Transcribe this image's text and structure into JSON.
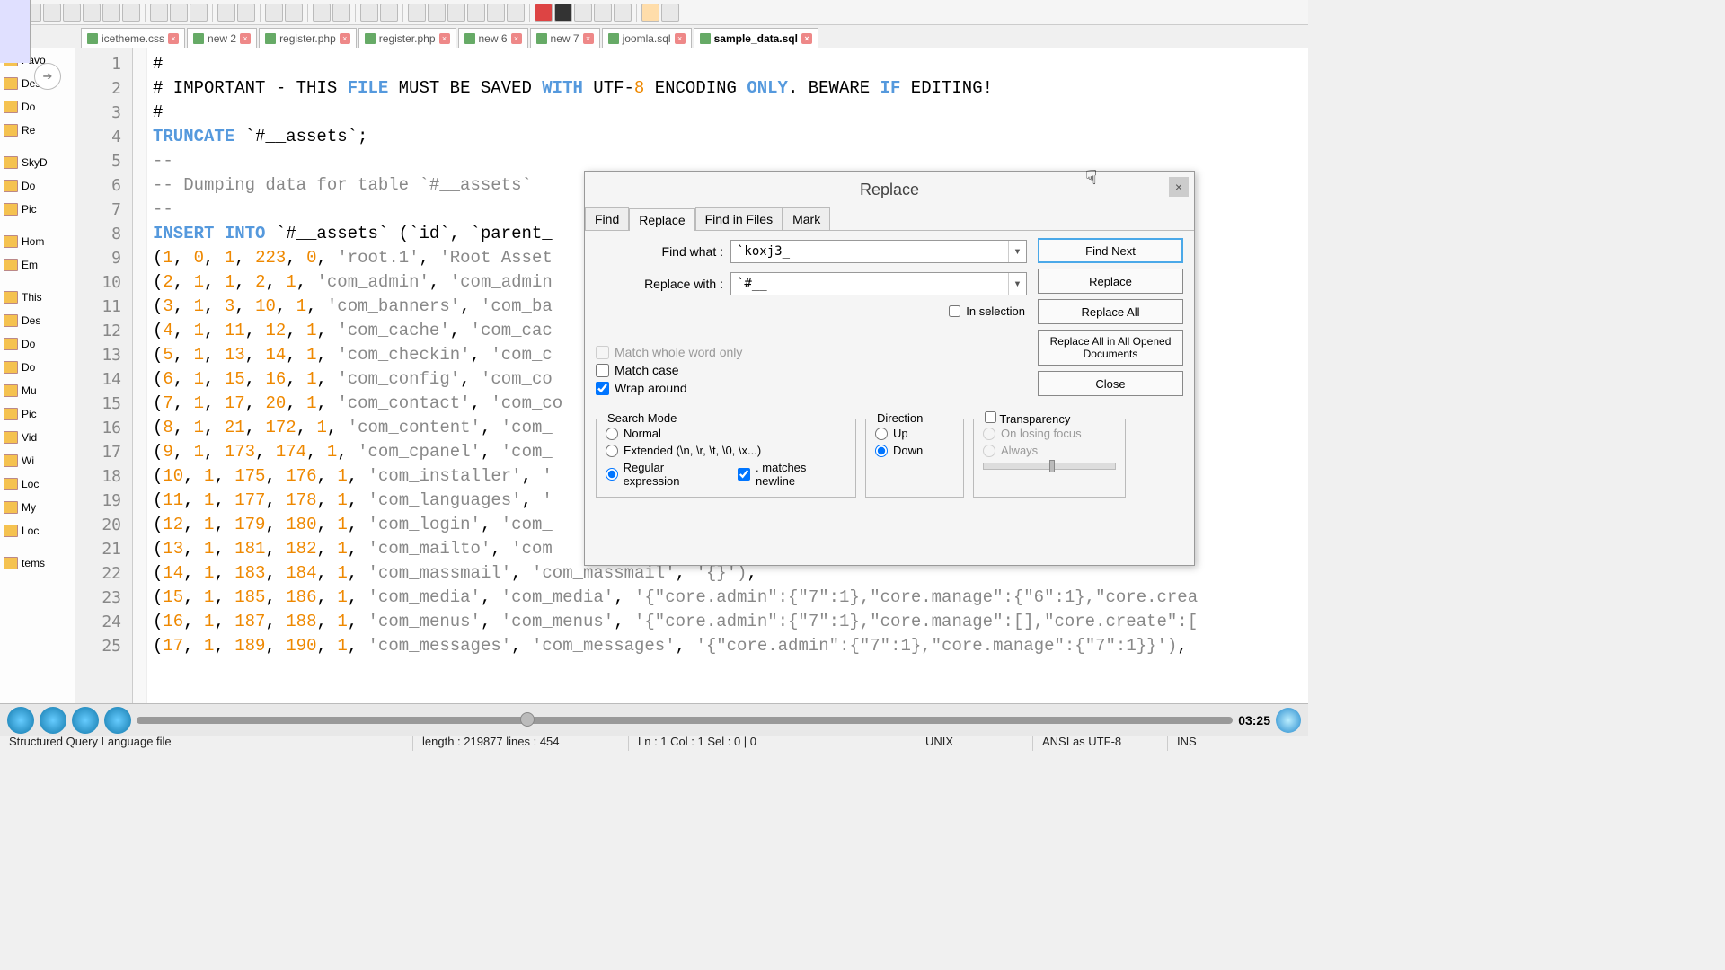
{
  "tabs": [
    {
      "label": "icetheme.css"
    },
    {
      "label": "new  2"
    },
    {
      "label": "register.php"
    },
    {
      "label": "register.php"
    },
    {
      "label": "new  6"
    },
    {
      "label": "new  7"
    },
    {
      "label": "joomla.sql"
    },
    {
      "label": "sample_data.sql"
    }
  ],
  "sidebar": {
    "items": [
      "Favo",
      "Des",
      "Do",
      "Re",
      "",
      "SkyD",
      "Do",
      "Pic",
      "",
      "Hom",
      "Em",
      "",
      "This",
      "Des",
      "Do",
      "Do",
      "Mu",
      "Pic",
      "Vid",
      "Wi",
      "Loc",
      "My",
      "Loc",
      "",
      "tems"
    ]
  },
  "editor": {
    "lines": [
      {
        "n": 1,
        "html": "#"
      },
      {
        "n": 2,
        "html": "# IMPORTANT - THIS <span class='kw'>FILE</span> MUST BE SAVED <span class='kw'>WITH</span> UTF-<span class='num'>8</span> ENCODING <span class='kw'>ONLY</span>. BEWARE <span class='kw'>IF</span> EDITING!"
      },
      {
        "n": 3,
        "html": "#"
      },
      {
        "n": 4,
        "html": "<span class='kw'>TRUNCATE</span> `#__assets`;"
      },
      {
        "n": 5,
        "html": "<span class='cmt'>--</span>"
      },
      {
        "n": 6,
        "html": "<span class='cmt'>-- Dumping data for table `#__assets`</span>"
      },
      {
        "n": 7,
        "html": "<span class='cmt'>--</span>"
      },
      {
        "n": 8,
        "html": "<span class='kw'>INSERT INTO</span> `#__assets` (`id`, `parent_                                                 <span class='kw'>UES</span>"
      },
      {
        "n": 9,
        "html": "(<span class='num'>1</span>, <span class='num'>0</span>, <span class='num'>1</span>, <span class='num'>223</span>, <span class='num'>0</span>, <span class='str'>'root.1'</span>, <span class='str'>'Root Asset                                                \"6\":1},</span>"
      },
      {
        "n": 10,
        "html": "(<span class='num'>2</span>, <span class='num'>1</span>, <span class='num'>1</span>, <span class='num'>2</span>, <span class='num'>1</span>, <span class='str'>'com_admin'</span>, <span class='str'>'com_admin</span>"
      },
      {
        "n": 11,
        "html": "(<span class='num'>3</span>, <span class='num'>1</span>, <span class='num'>3</span>, <span class='num'>10</span>, <span class='num'>1</span>, <span class='str'>'com_banners'</span>, <span class='str'>'com_ba                                                e.creat</span>"
      },
      {
        "n": 12,
        "html": "(<span class='num'>4</span>, <span class='num'>1</span>, <span class='num'>11</span>, <span class='num'>12</span>, <span class='num'>1</span>, <span class='str'>'com_cache'</span>, <span class='str'>'com_cac</span>"
      },
      {
        "n": 13,
        "html": "(<span class='num'>5</span>, <span class='num'>1</span>, <span class='num'>13</span>, <span class='num'>14</span>, <span class='num'>1</span>, <span class='str'>'com_checkin'</span>, <span class='str'>'com_c</span>"
      },
      {
        "n": 14,
        "html": "(<span class='num'>6</span>, <span class='num'>1</span>, <span class='num'>15</span>, <span class='num'>16</span>, <span class='num'>1</span>, <span class='str'>'com_config'</span>, <span class='str'>'com_co</span>"
      },
      {
        "n": 15,
        "html": "(<span class='num'>7</span>, <span class='num'>1</span>, <span class='num'>17</span>, <span class='num'>20</span>, <span class='num'>1</span>, <span class='str'>'com_contact'</span>, <span class='str'>'com_co                                               re.crea</span>"
      },
      {
        "n": 16,
        "html": "(<span class='num'>8</span>, <span class='num'>1</span>, <span class='num'>21</span>, <span class='num'>172</span>, <span class='num'>1</span>, <span class='str'>'com_content'</span>, <span class='str'>'com_                                               ore.cre</span>"
      },
      {
        "n": 17,
        "html": "(<span class='num'>9</span>, <span class='num'>1</span>, <span class='num'>173</span>, <span class='num'>174</span>, <span class='num'>1</span>, <span class='str'>'com_cpanel'</span>, <span class='str'>'com_</span>"
      },
      {
        "n": 18,
        "html": "(<span class='num'>10</span>, <span class='num'>1</span>, <span class='num'>175</span>, <span class='num'>176</span>, <span class='num'>1</span>, <span class='str'>'com_installer'</span>, <span class='str'>'                                               core.de</span>"
      },
      {
        "n": 19,
        "html": "(<span class='num'>11</span>, <span class='num'>1</span>, <span class='num'>177</span>, <span class='num'>178</span>, <span class='num'>1</span>, <span class='str'>'com_languages'</span>, <span class='str'>'                                               core.cr</span>"
      },
      {
        "n": 20,
        "html": "(<span class='num'>12</span>, <span class='num'>1</span>, <span class='num'>179</span>, <span class='num'>180</span>, <span class='num'>1</span>, <span class='str'>'com_login'</span>, <span class='str'>'com_</span>"
      },
      {
        "n": 21,
        "html": "(<span class='num'>13</span>, <span class='num'>1</span>, <span class='num'>181</span>, <span class='num'>182</span>, <span class='num'>1</span>, <span class='str'>'com_mailto'</span>, <span class='str'>'com</span>"
      },
      {
        "n": 22,
        "html": "(<span class='num'>14</span>, <span class='num'>1</span>, <span class='num'>183</span>, <span class='num'>184</span>, <span class='num'>1</span>, <span class='str'>'com_massmail'</span>, <span class='str'>'com_massmail'</span>, <span class='str'>'{}')</span>,"
      },
      {
        "n": 23,
        "html": "(<span class='num'>15</span>, <span class='num'>1</span>, <span class='num'>185</span>, <span class='num'>186</span>, <span class='num'>1</span>, <span class='str'>'com_media'</span>, <span class='str'>'com_media'</span>, <span class='str'>'{\"core.admin\":{\"7\":1},\"core.manage\":{\"6\":1},\"core.crea</span>"
      },
      {
        "n": 24,
        "html": "(<span class='num'>16</span>, <span class='num'>1</span>, <span class='num'>187</span>, <span class='num'>188</span>, <span class='num'>1</span>, <span class='str'>'com_menus'</span>, <span class='str'>'com_menus'</span>, <span class='str'>'{\"core.admin\":{\"7\":1},\"core.manage\":[],\"core.create\":[</span>"
      },
      {
        "n": 25,
        "html": "(<span class='num'>17</span>, <span class='num'>1</span>, <span class='num'>189</span>, <span class='num'>190</span>, <span class='num'>1</span>, <span class='str'>'com_messages'</span>, <span class='str'>'com_messages'</span>, <span class='str'>'{\"core.admin\":{\"7\":1},\"core.manage\":{\"7\":1}}')</span>,"
      }
    ]
  },
  "statusbar": {
    "filetype": "Structured Query Language file",
    "length": "length : 219877    lines : 454",
    "pos": "Ln : 1    Col : 1    Sel : 0 | 0",
    "eol": "UNIX",
    "enc": "ANSI as UTF-8",
    "mode": "INS"
  },
  "dialog": {
    "title": "Replace",
    "tabs": [
      "Find",
      "Replace",
      "Find in Files",
      "Mark"
    ],
    "find_label": "Find what :",
    "find_value": "`koxj3_",
    "replace_label": "Replace with :",
    "replace_value": "`#__",
    "in_selection": "In selection",
    "buttons": {
      "find_next": "Find Next",
      "replace": "Replace",
      "replace_all": "Replace All",
      "replace_all_docs": "Replace All in All Opened Documents",
      "close": "Close"
    },
    "match_whole": "Match whole word only",
    "match_case": "Match case",
    "wrap": "Wrap around",
    "search_mode": {
      "legend": "Search Mode",
      "normal": "Normal",
      "extended": "Extended (\\n, \\r, \\t, \\0, \\x...)",
      "regex": "Regular expression",
      "dot_newline": ". matches newline"
    },
    "direction": {
      "legend": "Direction",
      "up": "Up",
      "down": "Down"
    },
    "transparency": {
      "legend": "Transparency",
      "losing": "On losing focus",
      "always": "Always"
    }
  },
  "player": {
    "time": "03:25"
  }
}
